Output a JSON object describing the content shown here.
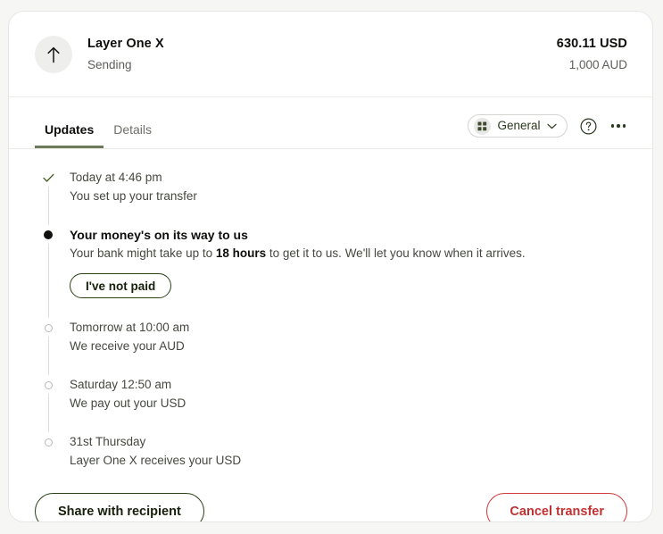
{
  "header": {
    "avatar_icon": "arrow-up-icon",
    "recipient_name": "Layer One X",
    "transfer_state": "Sending",
    "amount_primary": "630.11 USD",
    "amount_secondary": "1,000 AUD"
  },
  "tabbar": {
    "tabs": [
      {
        "label": "Updates",
        "active": true
      },
      {
        "label": "Details",
        "active": false
      }
    ],
    "chip": {
      "icon": "grid-squares-icon",
      "label": "General",
      "caret_icon": "chevron-down-icon"
    },
    "help_icon": "question-circle-icon",
    "more_icon": "more-horizontal-icon"
  },
  "timeline": [
    {
      "marker": "check-icon",
      "title": "Today at 4:46 pm",
      "subtitle": "You set up your transfer",
      "bold_title": false
    },
    {
      "marker": "filled-dot",
      "title": "Your money's on its way to us",
      "subtitle_pre": "Your bank might take up to ",
      "subtitle_bold": "18 hours",
      "subtitle_post": " to get it to us. We'll let you know when it arrives.",
      "bold_title": true,
      "action_label": "I've not paid"
    },
    {
      "marker": "hollow-dot",
      "title": "Tomorrow at 10:00 am",
      "subtitle": "We receive your AUD",
      "bold_title": false
    },
    {
      "marker": "hollow-dot",
      "title": "Saturday 12:50 am",
      "subtitle": "We pay out your USD",
      "bold_title": false
    },
    {
      "marker": "hollow-dot",
      "title": "31st Thursday",
      "subtitle": "Layer One X receives your USD",
      "bold_title": false
    }
  ],
  "footer": {
    "share_label": "Share with recipient",
    "cancel_label": "Cancel transfer"
  },
  "colors": {
    "page_background": "#f6f6f4",
    "card_background": "#ffffff",
    "accent_green": "#2b4216",
    "tab_underline": "#6c7a5a",
    "danger_red": "#c23131",
    "muted_text": "#5c5f5a"
  }
}
